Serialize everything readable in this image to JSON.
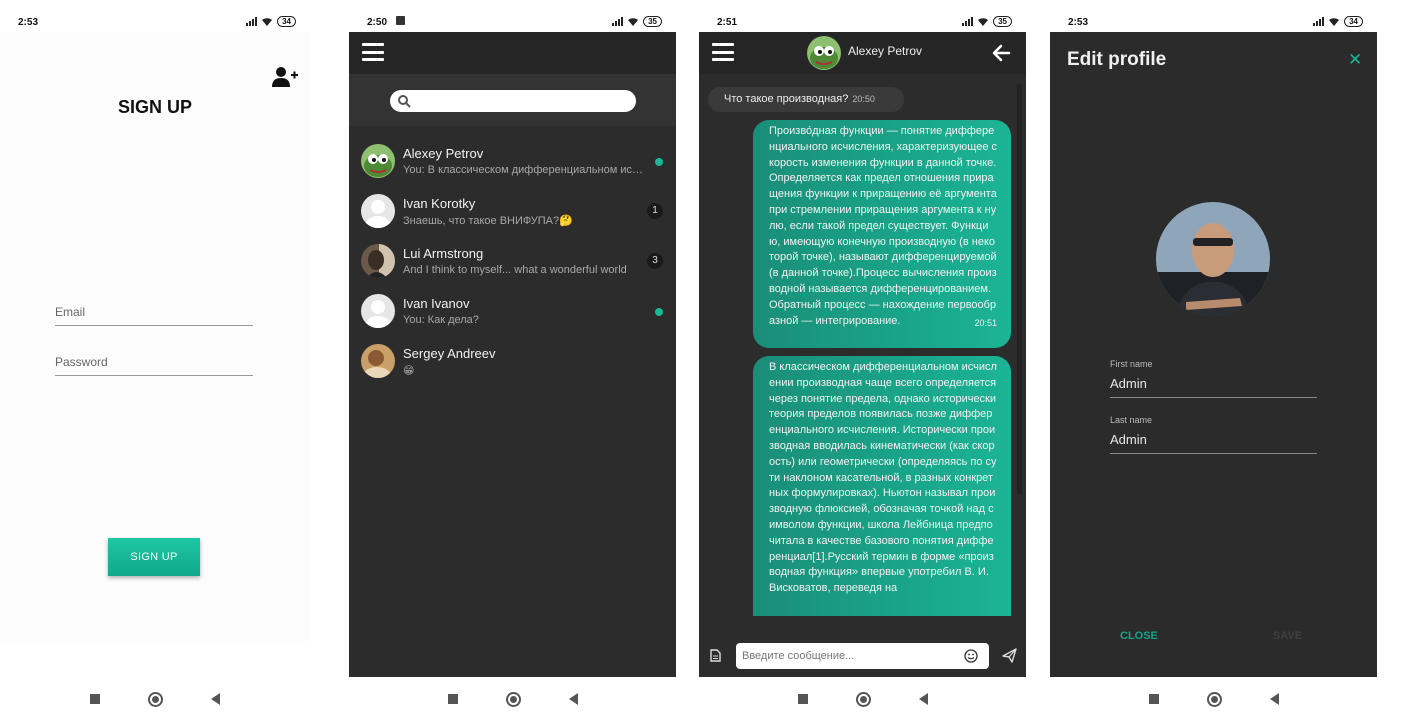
{
  "screen1": {
    "status": {
      "time": "2:53",
      "battery": "34"
    },
    "title": "SIGN UP",
    "email_placeholder": "Email",
    "password_placeholder": "Password",
    "button": "SIGN UP",
    "icons": [
      "add-user-icon"
    ]
  },
  "screen2": {
    "status": {
      "time": "2:50",
      "battery": "35"
    },
    "icons": [
      "menu-icon",
      "search-icon"
    ],
    "chats": [
      {
        "name": "Alexey Petrov",
        "preview": "You: В классическом дифференциальном исчислении",
        "online": true,
        "unread": ""
      },
      {
        "name": "Ivan Korotky",
        "preview": "Знаешь, что такое ВНИФУПА?🤔",
        "online": false,
        "unread": "1"
      },
      {
        "name": "Lui Armstrong",
        "preview": "And I think to myself... what a wonderful world",
        "online": false,
        "unread": "3"
      },
      {
        "name": "Ivan Ivanov",
        "preview": "You: Как дела?",
        "online": true,
        "unread": ""
      },
      {
        "name": "Sergey Andreev",
        "preview": "😁",
        "online": false,
        "unread": ""
      }
    ]
  },
  "screen3": {
    "status": {
      "time": "2:51",
      "battery": "35"
    },
    "contact": "Alexey Petrov",
    "incoming": {
      "text": "Что такое производная?",
      "time": "20:50"
    },
    "outgoing": [
      {
        "text": "Произво́дная функции — понятие дифференциального исчисления, характеризующее скорость изменения функции в данной точке. Определяется как предел отношения приращения функции к приращению её аргумента при стремлении приращения аргумента к нулю, если такой предел существует. Функцию, имеющую конечную производную (в некоторой точке), называют дифференцируемой (в данной точке).Процесс вычисления производной называется дифференцированием. Обратный процесс — нахождение первообразной — интегрирование.",
        "time": "20:51"
      },
      {
        "text": "В классическом дифференциальном исчислении производная чаще всего определяется через понятие предела, однако исторически теория пределов появилась позже дифференциального исчисления. Исторически производная вводилась кинематически (как скорость) или геометрически (определяясь по сути наклоном касательной, в разных конкретных формулировках). Ньютон называл производную флюксией, обозначая точкой над символом функции, школа Лейбница предпочитала в качестве базового понятия дифференциал[1].Русский термин в форме «производная функция» впервые употребил В. И. Висковатов, переведя на",
        "time": ""
      }
    ],
    "input_placeholder": "Введите сообщение...",
    "icons": [
      "menu-icon",
      "back-arrow-icon",
      "attach-file-icon",
      "emoji-icon",
      "send-icon"
    ]
  },
  "screen4": {
    "status": {
      "time": "2:53",
      "battery": "34"
    },
    "title": "Edit profile",
    "close_symbol": "✕",
    "first_name_label": "First name",
    "first_name_value": "Admin",
    "last_name_label": "Last name",
    "last_name_value": "Admin",
    "close_button": "CLOSE",
    "save_button": "SAVE"
  },
  "colors": {
    "accent": "#16b596",
    "dark_bg": "#2c2c2c",
    "topbar": "#262626"
  }
}
